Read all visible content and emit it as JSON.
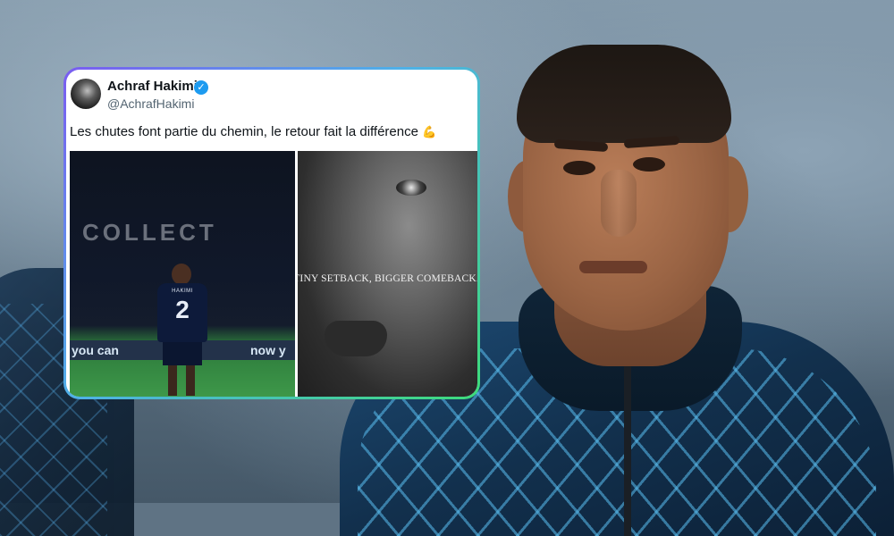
{
  "background": {
    "jersey_color": "#1d4a73",
    "pattern_color": "#5abef0"
  },
  "tweet": {
    "author_name": "Achraf Hakimi",
    "handle": "@AchrafHakimi",
    "verified_icon": "verified-badge-icon",
    "verified_color": "#1d9bf0",
    "text": "Les chutes font partie du chemin, le retour fait la différence",
    "emoji_icon": "flexed-biceps-icon",
    "border_gradient": [
      "#7a5cf0",
      "#4fb0e8",
      "#3ddc7a"
    ],
    "media": {
      "left_image": {
        "banner_text": "COLLECT",
        "ad_left": "you can",
        "ad_right": "now y",
        "shirt_name": "HAKIMI",
        "shirt_number": "2"
      },
      "right_image": {
        "caption": "TINY SETBACK, BIGGER COMEBACK."
      }
    }
  }
}
